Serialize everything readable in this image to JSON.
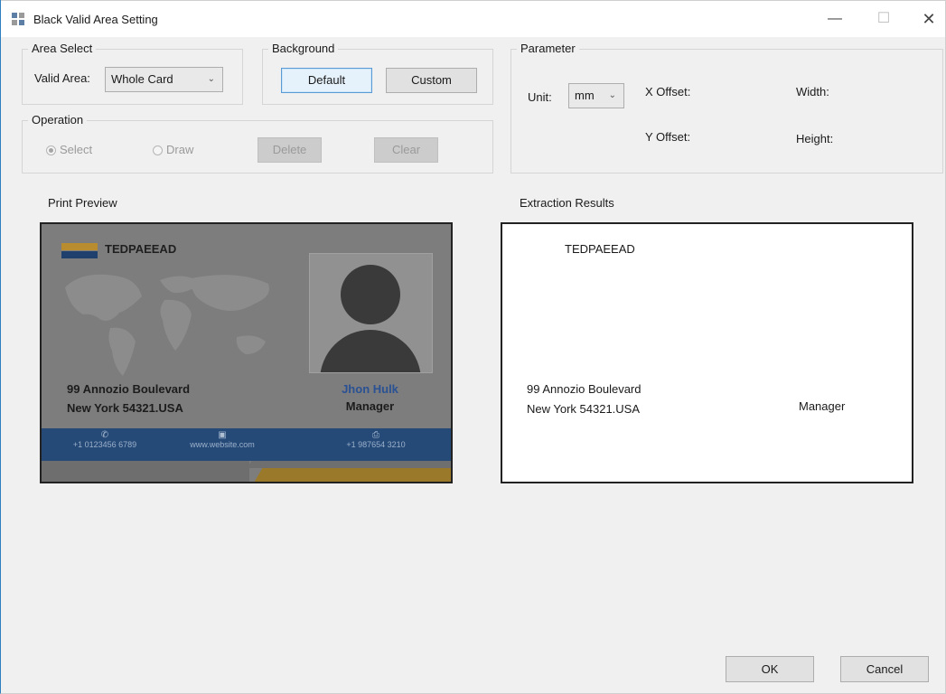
{
  "window": {
    "title": "Black Valid Area Setting",
    "min": "—",
    "max": "☐",
    "close": "✕"
  },
  "area_select": {
    "legend": "Area Select",
    "label": "Valid Area:",
    "value": "Whole Card"
  },
  "background": {
    "legend": "Background",
    "default_label": "Default",
    "custom_label": "Custom"
  },
  "parameter": {
    "legend": "Parameter",
    "unit_label": "Unit:",
    "unit_value": "mm",
    "x_offset": "X Offset:",
    "y_offset": "Y Offset:",
    "width": "Width:",
    "height": "Height:"
  },
  "operation": {
    "legend": "Operation",
    "select": "Select",
    "draw": "Draw",
    "delete_label": "Delete",
    "clear_label": "Clear",
    "selected": "select"
  },
  "preview": {
    "label": "Print Preview",
    "company": "TEDPAEEAD",
    "address1": "99 Annozio Boulevard",
    "address2": "New York 54321.USA",
    "name": "Jhon Hulk",
    "role": "Manager",
    "phone1": "+1 0123456 6789",
    "website": "www.website.com",
    "phone2": "+1 987654 3210"
  },
  "results": {
    "label": "Extraction Results",
    "company": "TEDPAEEAD",
    "address1": "99 Annozio Boulevard",
    "address2": "New York 54321.USA",
    "role": "Manager"
  },
  "footer": {
    "ok_label": "OK",
    "cancel_label": "Cancel"
  }
}
